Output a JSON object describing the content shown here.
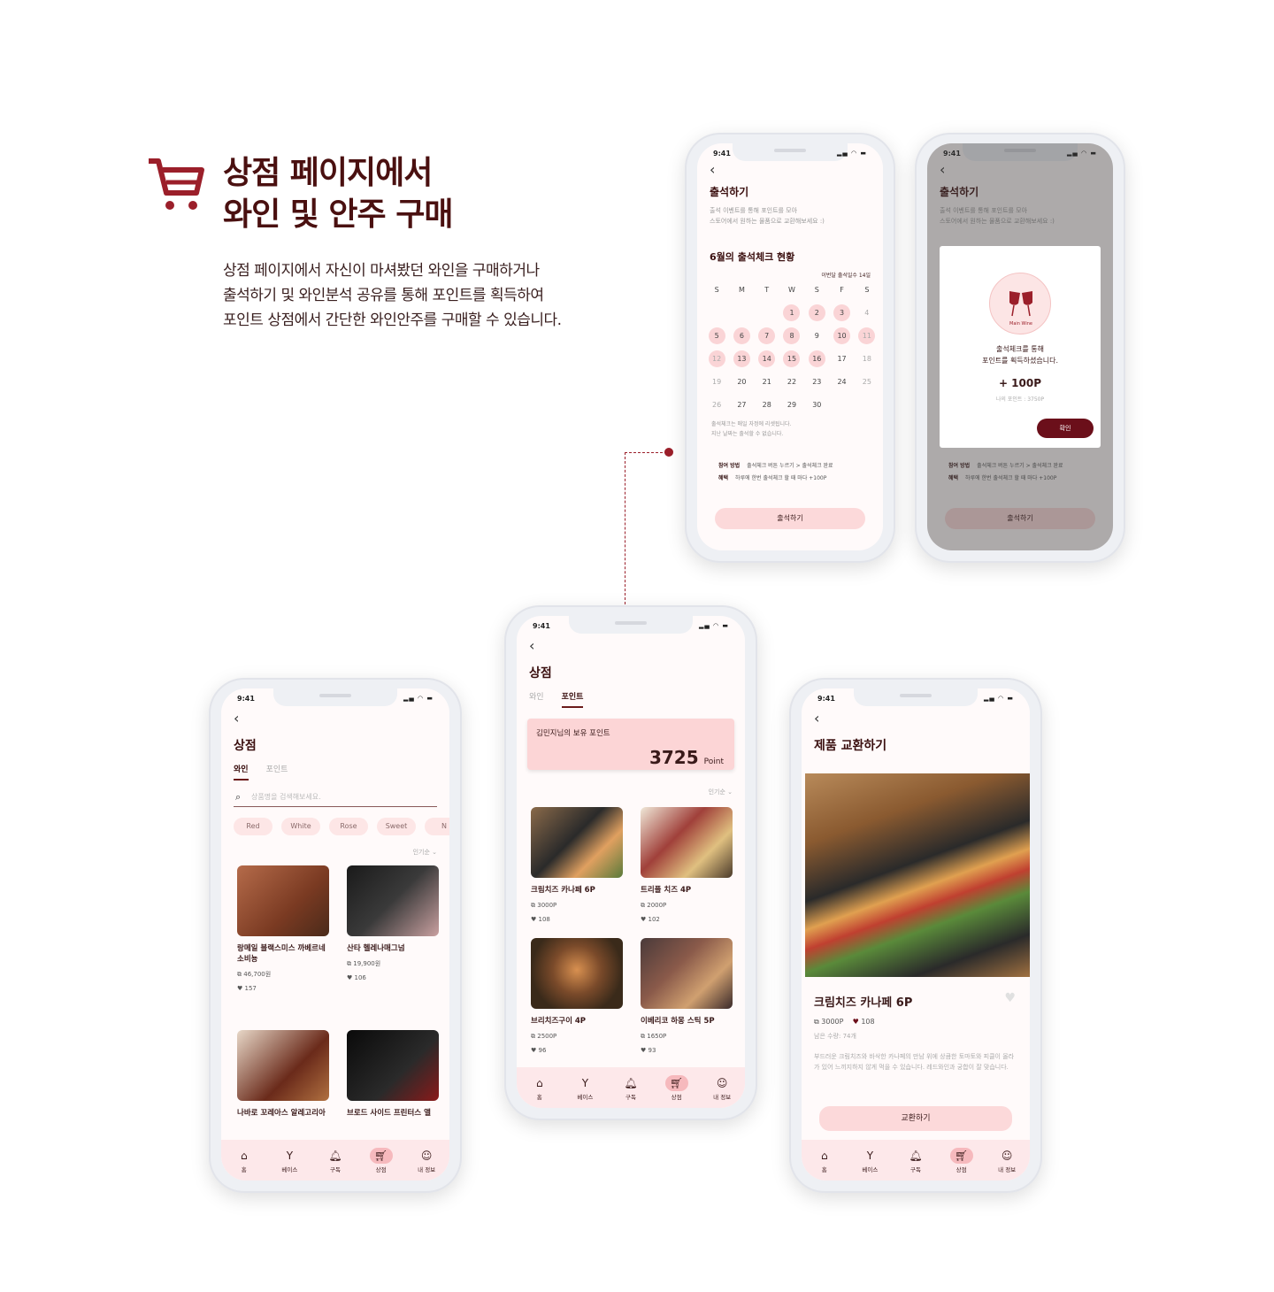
{
  "header": {
    "title_lines": [
      "상점 페이지에서",
      "와인 및 안주 구매"
    ],
    "desc_lines": [
      "상점 페이지에서 자신이 마셔봤던 와인을 구매하거나",
      "출석하기 및 와인분석 공유를 통해 포인트를 획득하여",
      "포인트 상점에서 간단한 와인안주를 구매할 수 있습니다."
    ],
    "icon": "cart-icon",
    "accent": "#9b1f2a"
  },
  "status_time": "9:41",
  "tabbar": [
    "홈",
    "베이스",
    "구독",
    "상점",
    "내 정보"
  ],
  "shop_wine": {
    "title": "상점",
    "tabs": [
      "와인",
      "포인트"
    ],
    "search_placeholder": "상품명을 검색해보세요.",
    "chips": [
      "Red",
      "White",
      "Rose",
      "Sweet",
      "N"
    ],
    "sort": "인기순",
    "items": [
      {
        "name": "랑메일 블랙스미스 까베르네 소비뇽",
        "price": "46,700원",
        "likes": "157"
      },
      {
        "name": "산타 헬레나매그넘",
        "price": "19,900원",
        "likes": "106"
      },
      {
        "name": "나바로 꼬레아스 알레고리아",
        "price": "",
        "likes": ""
      },
      {
        "name": "브로드 사이드 프린터스 앨",
        "price": "",
        "likes": ""
      }
    ]
  },
  "shop_point": {
    "title": "상점",
    "tabs": [
      "와인",
      "포인트"
    ],
    "point_label": "김민지님의 보유 포인트",
    "point_value": "3725",
    "point_unit": "Point",
    "sort": "인기순",
    "items": [
      {
        "name": "크림치즈 카나페 6P",
        "price": "3000P",
        "likes": "108"
      },
      {
        "name": "트리플 치즈 4P",
        "price": "2000P",
        "likes": "102"
      },
      {
        "name": "브리치즈구이 4P",
        "price": "2500P",
        "likes": "96"
      },
      {
        "name": "이베리코 하몽 스틱 5P",
        "price": "1650P",
        "likes": "93"
      }
    ]
  },
  "attendance": {
    "title": "출석하기",
    "sub_lines": [
      "출석 이벤트를 통해 포인트를 모아",
      "스토어에서 원하는 물품으로 교환해보세요 :)"
    ],
    "month_title": "6월의 출석체크 현황",
    "badge": "이번달 출석일수 14일",
    "weekdays": [
      "S",
      "M",
      "T",
      "W",
      "S",
      "F",
      "S"
    ],
    "note_lines": [
      "출석체크는 매일 자정에 리셋됩니다.",
      "지난 날짜는 출석할 수 없습니다."
    ],
    "how_label": "참여 방법",
    "how_text": "출석체크 버튼 누르기 > 출석체크 완료",
    "benefit_label": "혜택",
    "benefit_text": "하루에 한번 출석체크 할 때 마다 +100P",
    "button": "출석하기"
  },
  "modal": {
    "logo_text": "Main Wine",
    "msg_lines": [
      "출석체크를 통해",
      "포인트를 획득하셨습니다."
    ],
    "points": "+ 100P",
    "my_points": "나의 포인트 : 3750P",
    "confirm": "확인"
  },
  "product": {
    "title": "제품 교환하기",
    "name": "크림치즈 카나페 6P",
    "price": "3000P",
    "likes": "108",
    "stock": "남은 수량: 74개",
    "desc": "부드러운 크림치즈와 바삭한 카나페의 만남 위에 상큼한 토마토와 피클이 올라가 있어 느끼지하지 않게 먹을 수 있습니다. 레드와인과 궁합이 잘 맞습니다.",
    "button": "교환하기"
  }
}
